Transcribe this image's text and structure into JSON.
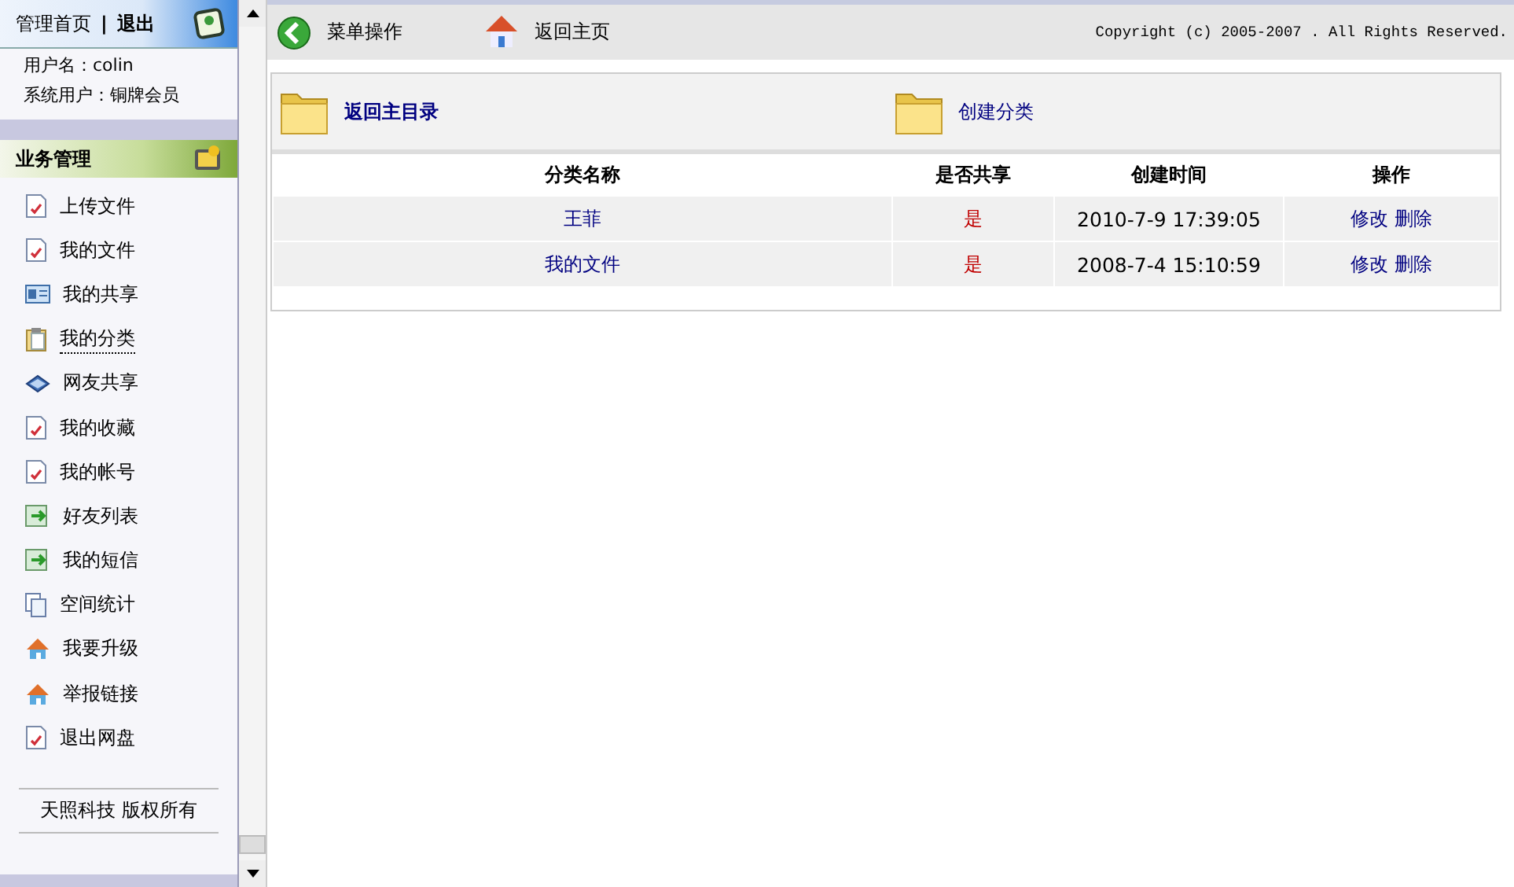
{
  "sidebar": {
    "home_link": "管理首页",
    "separator": "|",
    "logout_link": "退出",
    "user_name": "用户名：colin",
    "user_level": "系统用户：铜牌会员",
    "section_title": "业务管理",
    "items": [
      {
        "label": "上传文件",
        "kind": "document",
        "selected": false
      },
      {
        "label": "我的文件",
        "kind": "document",
        "selected": false
      },
      {
        "label": "我的共享",
        "kind": "card",
        "selected": false
      },
      {
        "label": "我的分类",
        "kind": "clipboard",
        "selected": true
      },
      {
        "label": "网友共享",
        "kind": "drive",
        "selected": false
      },
      {
        "label": "我的收藏",
        "kind": "document",
        "selected": false
      },
      {
        "label": "我的帐号",
        "kind": "document",
        "selected": false
      },
      {
        "label": "好友列表",
        "kind": "transfer",
        "selected": false
      },
      {
        "label": "我的短信",
        "kind": "transfer",
        "selected": false
      },
      {
        "label": "空间统计",
        "kind": "pages",
        "selected": false
      },
      {
        "label": "我要升级",
        "kind": "house",
        "selected": false
      },
      {
        "label": "举报链接",
        "kind": "house",
        "selected": false
      },
      {
        "label": "退出网盘",
        "kind": "document",
        "selected": false
      }
    ],
    "footer": "天照科技 版权所有"
  },
  "toolbar": {
    "menu_label": "菜单操作",
    "home_label": "返回主页",
    "copyright": "Copyright (c) 2005-2007 . All Rights Reserved."
  },
  "panel": {
    "back_link": "返回主目录",
    "create_link": "创建分类",
    "table": {
      "columns": [
        "分类名称",
        "是否共享",
        "创建时间",
        "操作"
      ],
      "rows": [
        {
          "name": "王菲",
          "shared": "是",
          "created": "2010-7-9 17:39:05",
          "edit": "修改",
          "delete": "删除"
        },
        {
          "name": "我的文件",
          "shared": "是",
          "created": "2008-7-4 15:10:59",
          "edit": "修改",
          "delete": "删除"
        }
      ]
    }
  }
}
